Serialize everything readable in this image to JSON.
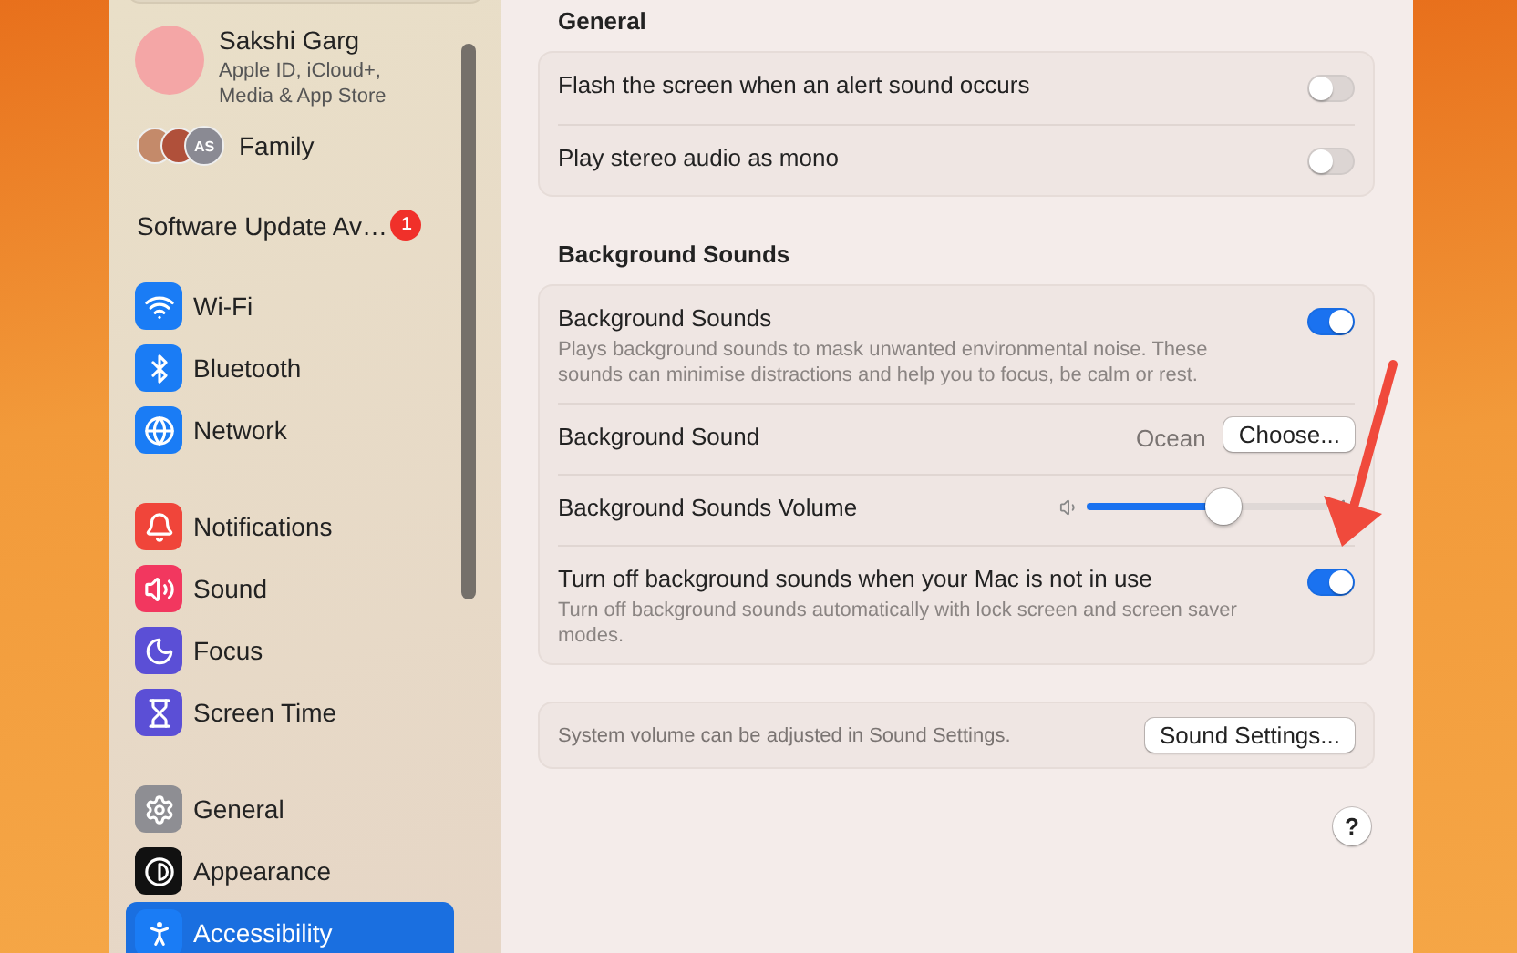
{
  "sidebar": {
    "account": {
      "name": "Sakshi Garg",
      "subtitle": "Apple ID, iCloud+,\nMedia & App Store"
    },
    "family": {
      "label": "Family",
      "initials": "AS"
    },
    "update": {
      "label": "Software Update Av…",
      "badge": "1"
    },
    "groups": [
      {
        "items": [
          {
            "label": "Wi-Fi",
            "kind": "wifi",
            "color": "#1a7cf5",
            "selected": false
          },
          {
            "label": "Bluetooth",
            "kind": "bluetooth",
            "color": "#1a7cf5",
            "selected": false
          },
          {
            "label": "Network",
            "kind": "globe",
            "color": "#1a7cf5",
            "selected": false
          }
        ]
      },
      {
        "items": [
          {
            "label": "Notifications",
            "kind": "bell",
            "color": "#f0453a",
            "selected": false
          },
          {
            "label": "Sound",
            "kind": "sound",
            "color": "#f2375f",
            "selected": false
          },
          {
            "label": "Focus",
            "kind": "moon",
            "color": "#5b4fd6",
            "selected": false
          },
          {
            "label": "Screen Time",
            "kind": "hourglass",
            "color": "#5b4fd6",
            "selected": false
          }
        ]
      },
      {
        "items": [
          {
            "label": "General",
            "kind": "gear",
            "color": "#8e8e93",
            "selected": false
          },
          {
            "label": "Appearance",
            "kind": "contrast",
            "color": "#111111",
            "selected": false
          },
          {
            "label": "Accessibility",
            "kind": "person",
            "color": "#1a7cf5",
            "selected": true
          }
        ]
      }
    ]
  },
  "sections": [
    {
      "title": "General",
      "rows": [
        {
          "kind": "toggle",
          "label": "Flash the screen when an alert sound occurs",
          "on": false
        },
        {
          "kind": "toggle",
          "label": "Play stereo audio as mono",
          "on": false
        }
      ]
    },
    {
      "title": "Background Sounds",
      "rows": [
        {
          "kind": "toggle",
          "label": "Background Sounds",
          "description": "Plays background sounds to mask unwanted environmental noise. These sounds can minimise distractions and help you to focus, be calm or rest.",
          "on": true
        },
        {
          "kind": "choose",
          "label": "Background Sound",
          "value": "Ocean",
          "button": "Choose..."
        },
        {
          "kind": "slider",
          "label": "Background Sounds Volume",
          "level": 0.57
        },
        {
          "kind": "toggle",
          "label": "Turn off background sounds when your Mac is not in use",
          "description": "Turn off background sounds automatically with lock screen and screen saver modes.",
          "on": true
        }
      ]
    }
  ],
  "footer": {
    "text": "System volume can be adjusted in Sound Settings.",
    "button": "Sound Settings..."
  },
  "help": "?"
}
